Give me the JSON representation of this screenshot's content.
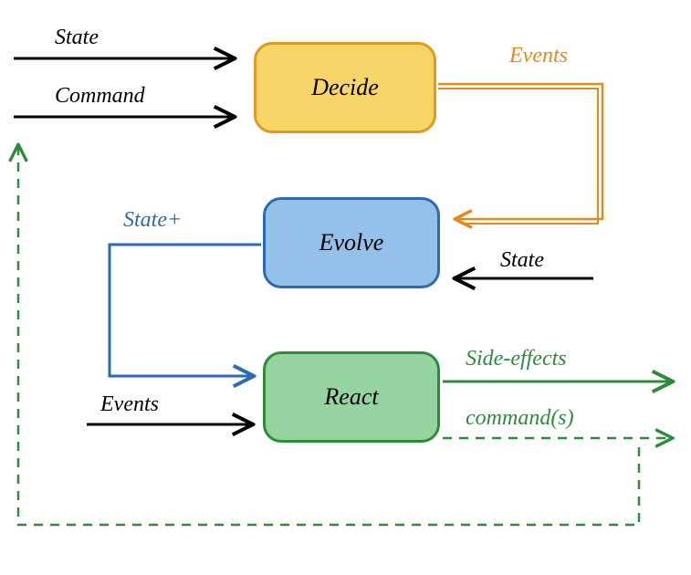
{
  "nodes": {
    "decide": {
      "label": "Decide"
    },
    "evolve": {
      "label": "Evolve"
    },
    "react": {
      "label": "React"
    }
  },
  "edges": {
    "state_in": {
      "label": "State"
    },
    "command_in": {
      "label": "Command"
    },
    "events_out": {
      "label": "Events"
    },
    "state_plus": {
      "label": "State+"
    },
    "state_in2": {
      "label": "State"
    },
    "events_in": {
      "label": "Events"
    },
    "side_effects": {
      "label": "Side-effects"
    },
    "commands_out": {
      "label": "command(s)"
    }
  },
  "colors": {
    "decide_fill": "#f8d568",
    "decide_stroke": "#e09a1f",
    "evolve_fill": "#94c0e9",
    "evolve_stroke": "#2b6cb0",
    "react_fill": "#95d4a0",
    "react_stroke": "#2e8b3e",
    "orange": "#e08a1f",
    "blue": "#2b6cb0",
    "green": "#2e8b3e",
    "black": "#000000"
  }
}
